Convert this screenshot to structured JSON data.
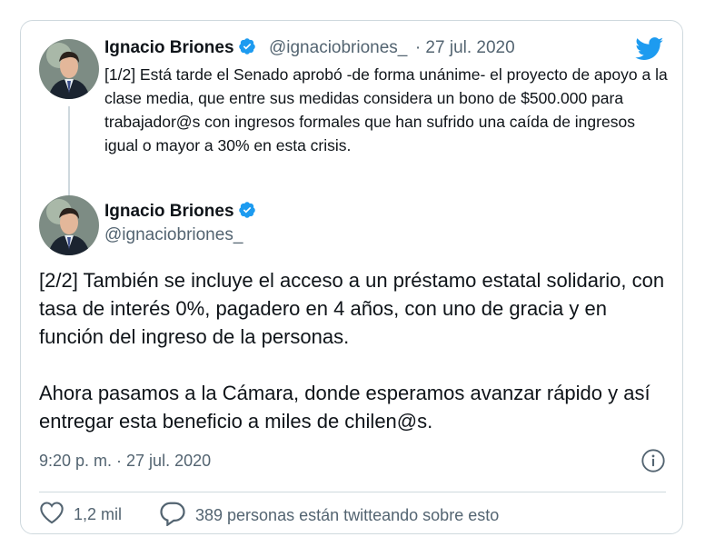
{
  "quoted_tweet": {
    "author_name": "Ignacio Briones",
    "handle": "@ignaciobriones_",
    "date": "· 27 jul. 2020",
    "text": "[1/2] Está tarde el Senado aprobó -de forma unánime- el proyecto de apoyo a la clase media, que entre sus medidas considera un bono de $500.000 para trabajador@s con ingresos formales que han sufrido una caída de ingresos igual o mayor a 30% en esta crisis."
  },
  "main_tweet": {
    "author_name": "Ignacio Briones",
    "handle": "@ignaciobriones_",
    "text": "[2/2] También se incluye el acceso a un préstamo estatal solidario, con tasa de interés 0%, pagadero en 4 años, con uno de gracia y en función del ingreso de la personas.\n\nAhora pasamos a la Cámara, donde esperamos avanzar rápido y así entregar esta beneficio a miles de chilen@s.",
    "timestamp": "9:20 p. m. · 27 jul. 2020"
  },
  "actions": {
    "likes": "1,2 mil",
    "conversation": "389 personas están twitteando sobre esto"
  },
  "colors": {
    "brand": "#1d9bf0",
    "muted": "#536471",
    "border": "#cfd9de"
  },
  "icons": [
    "twitter-bird-icon",
    "verified-badge-icon",
    "info-icon",
    "heart-icon",
    "reply-bubble-icon"
  ]
}
